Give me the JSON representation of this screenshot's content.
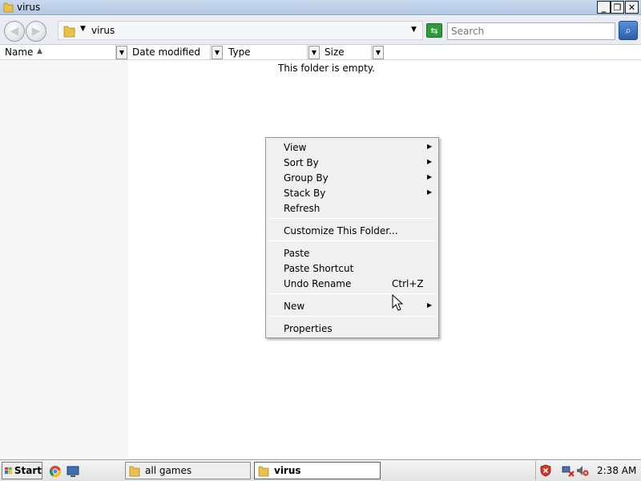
{
  "window": {
    "title": "virus",
    "controls": {
      "minimize": "_",
      "maximize": "❐",
      "close": "✕"
    }
  },
  "toolbar": {
    "back_icon": "back-arrow-icon",
    "forward_icon": "forward-arrow-icon",
    "address_path": "virus",
    "search_placeholder": "Search"
  },
  "columns": [
    {
      "label": "Name"
    },
    {
      "label": "Date modified"
    },
    {
      "label": "Type"
    },
    {
      "label": "Size"
    }
  ],
  "content": {
    "empty_message": "This folder is empty."
  },
  "context_menu": {
    "items": [
      {
        "label": "View",
        "submenu": true
      },
      {
        "label": "Sort By",
        "submenu": true
      },
      {
        "label": "Group By",
        "submenu": true
      },
      {
        "label": "Stack By",
        "submenu": true
      },
      {
        "label": "Refresh"
      },
      {
        "label": "Customize This Folder..."
      },
      {
        "label": "Paste"
      },
      {
        "label": "Paste Shortcut"
      },
      {
        "label": "Undo Rename",
        "shortcut": "Ctrl+Z"
      },
      {
        "label": "New",
        "submenu": true
      },
      {
        "label": "Properties"
      }
    ]
  },
  "taskbar": {
    "start_label": "Start",
    "buttons": [
      {
        "label": "all games",
        "active": false
      },
      {
        "label": "virus",
        "active": true
      }
    ],
    "clock": "2:38 AM"
  },
  "colors": {
    "titlebar": "#b4c8e4",
    "menu_bg": "#f0f0f0",
    "folder": "#e8c04a"
  }
}
